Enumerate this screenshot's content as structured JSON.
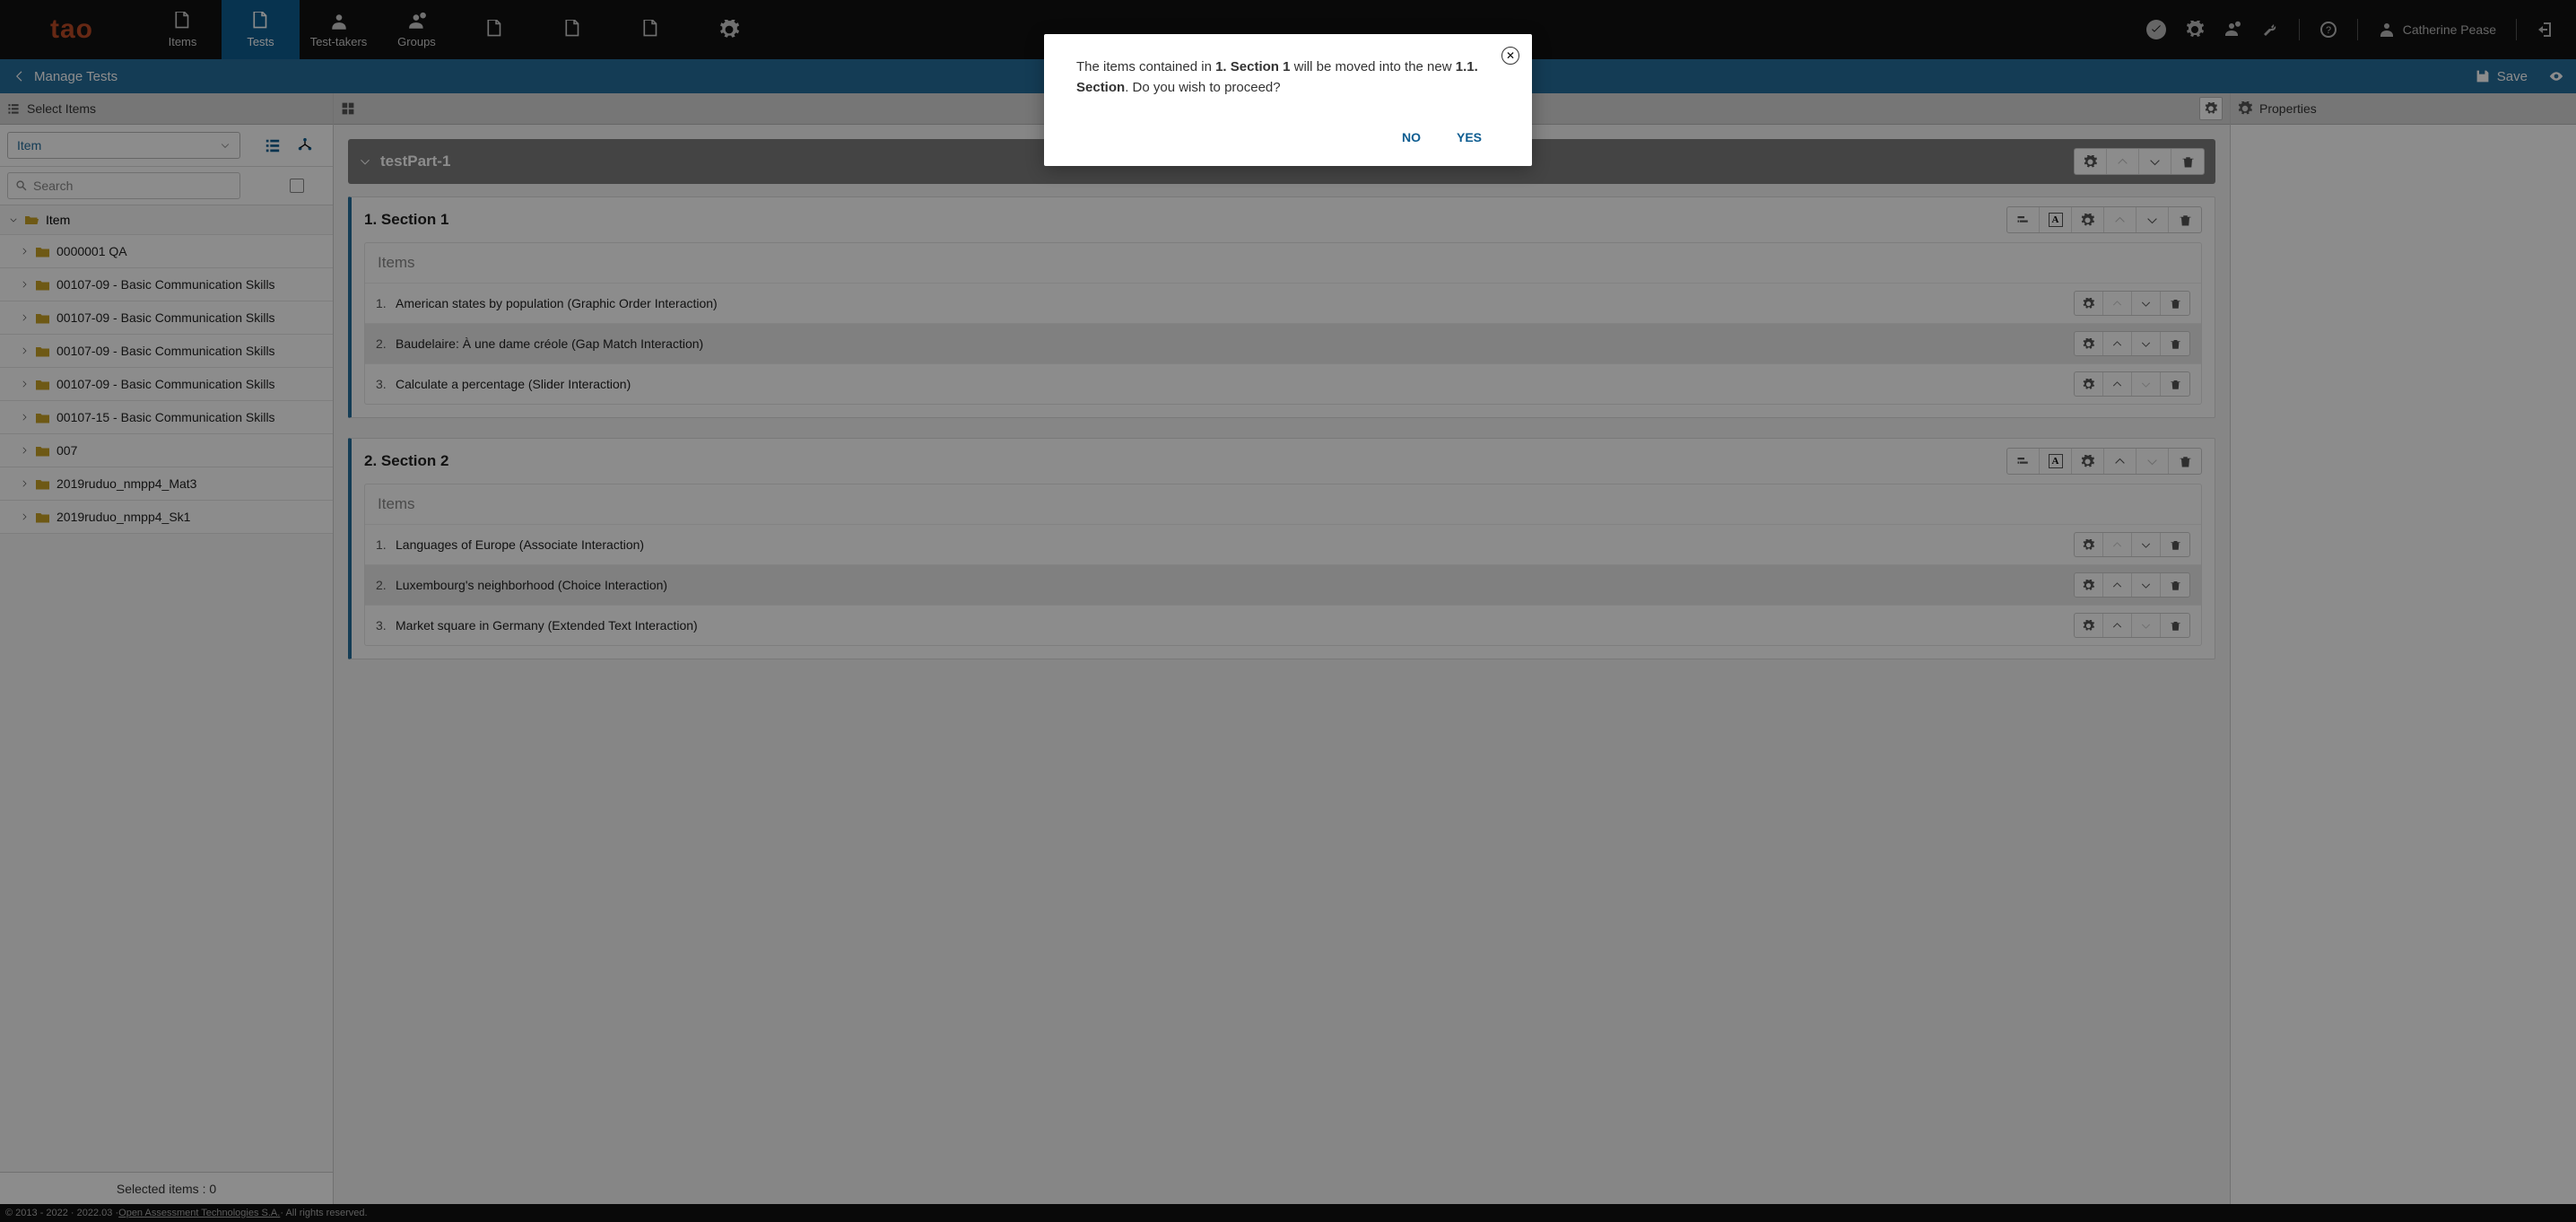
{
  "nav": {
    "tabs": [
      {
        "label": "Items"
      },
      {
        "label": "Tests"
      },
      {
        "label": "Test-takers"
      },
      {
        "label": "Groups"
      }
    ],
    "user": "Catherine Pease"
  },
  "subbar": {
    "title": "Manage Tests",
    "save": "Save"
  },
  "left": {
    "header": "Select Items",
    "filter": "Item",
    "search_placeholder": "Search",
    "root": "Item",
    "folders": [
      "0000001 QA",
      "00107-09 - Basic Communication Skills",
      "00107-09 - Basic Communication Skills",
      "00107-09 - Basic Communication Skills",
      "00107-09 - Basic Communication Skills",
      "00107-15 - Basic Communication Skills",
      "007",
      "2019ruduo_nmpp4_Mat3",
      "2019ruduo_nmpp4_Sk1"
    ],
    "selected": "Selected items : 0"
  },
  "center": {
    "testpart": "testPart-1",
    "sections": [
      {
        "title": "1. Section 1",
        "items_label": "Items",
        "items": [
          "American states by population (Graphic Order Interaction)",
          "Baudelaire: À une dame créole (Gap Match Interaction)",
          "Calculate a percentage (Slider Interaction)"
        ]
      },
      {
        "title": "2. Section 2",
        "items_label": "Items",
        "items": [
          "Languages of Europe (Associate Interaction)",
          "Luxembourg's neighborhood (Choice Interaction)",
          "Market square in Germany (Extended Text Interaction)"
        ]
      }
    ]
  },
  "right": {
    "header": "Properties"
  },
  "modal": {
    "pre": "The items contained in ",
    "b1": "1. Section 1",
    "mid": " will be moved into the new ",
    "b2": "1.1. Section",
    "post": ". Do you wish to proceed?",
    "no": "NO",
    "yes": "YES"
  },
  "footer": {
    "left": "© 2013 - 2022 · 2022.03 · ",
    "link": "Open Assessment Technologies S.A.",
    "right": " · All rights reserved."
  }
}
